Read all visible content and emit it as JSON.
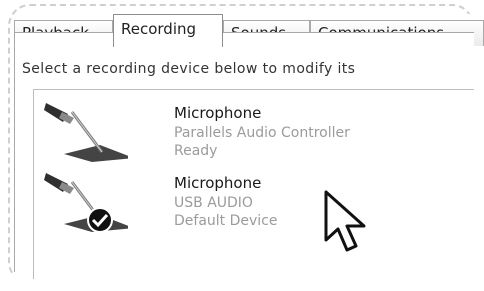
{
  "tabs": [
    {
      "label": "Playback"
    },
    {
      "label": "Recording"
    },
    {
      "label": "Sounds"
    },
    {
      "label": "Communications"
    }
  ],
  "active_tab": "Recording",
  "instruction": "Select a recording device below to modify its",
  "devices": [
    {
      "name": "Microphone",
      "driver": "Parallels Audio Controller",
      "status": "Ready",
      "icon": "microphone-icon",
      "is_default": false
    },
    {
      "name": "Microphone",
      "driver": "USB AUDIO",
      "status": "Default Device",
      "icon": "microphone-icon",
      "is_default": true
    }
  ],
  "cursor_icon": "mouse-pointer-icon",
  "colors": {
    "tab_border": "#a9a9a9",
    "secondary_text": "#9b9b9b",
    "default_badge": "#111111"
  }
}
